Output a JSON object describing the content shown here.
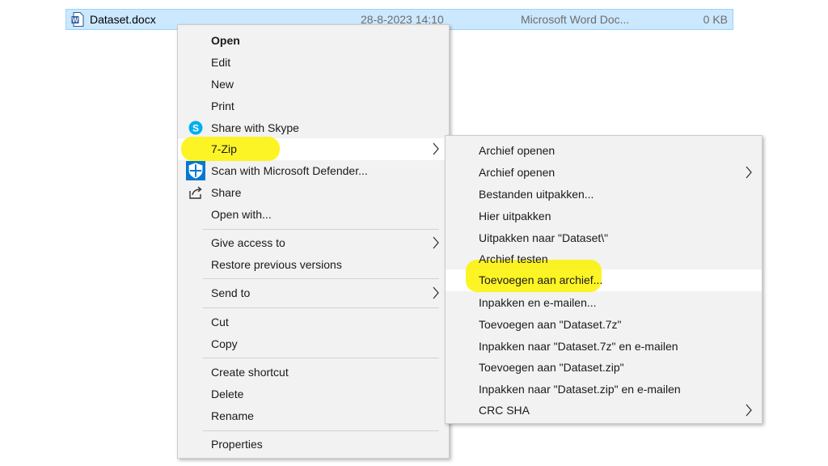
{
  "file": {
    "name": "Dataset.docx",
    "date": "28-8-2023 14:10",
    "type": "Microsoft Word Doc...",
    "size": "0 KB"
  },
  "context_menu": {
    "open": "Open",
    "edit": "Edit",
    "new": "New",
    "print": "Print",
    "share_skype": "Share with Skype",
    "seven_zip": "7-Zip",
    "scan_defender": "Scan with Microsoft Defender...",
    "share": "Share",
    "open_with": "Open with...",
    "give_access": "Give access to",
    "restore_versions": "Restore previous versions",
    "send_to": "Send to",
    "cut": "Cut",
    "copy": "Copy",
    "create_shortcut": "Create shortcut",
    "delete": "Delete",
    "rename": "Rename",
    "properties": "Properties"
  },
  "submenu_7zip": [
    "Archief openen",
    "Archief openen",
    "Bestanden uitpakken...",
    "Hier uitpakken",
    "Uitpakken naar \"Dataset\\\"",
    "Archief testen",
    "Toevoegen aan archief...",
    "Inpakken en e-mailen...",
    "Toevoegen aan \"Dataset.7z\"",
    "Inpakken naar \"Dataset.7z\" en e-mailen",
    "Toevoegen aan \"Dataset.zip\"",
    "Inpakken naar \"Dataset.zip\" en e-mailen",
    "CRC SHA"
  ],
  "colors": {
    "highlighter": "#fdf200",
    "selection": "#cce8ff",
    "menu_bg": "#f2f2f2"
  }
}
